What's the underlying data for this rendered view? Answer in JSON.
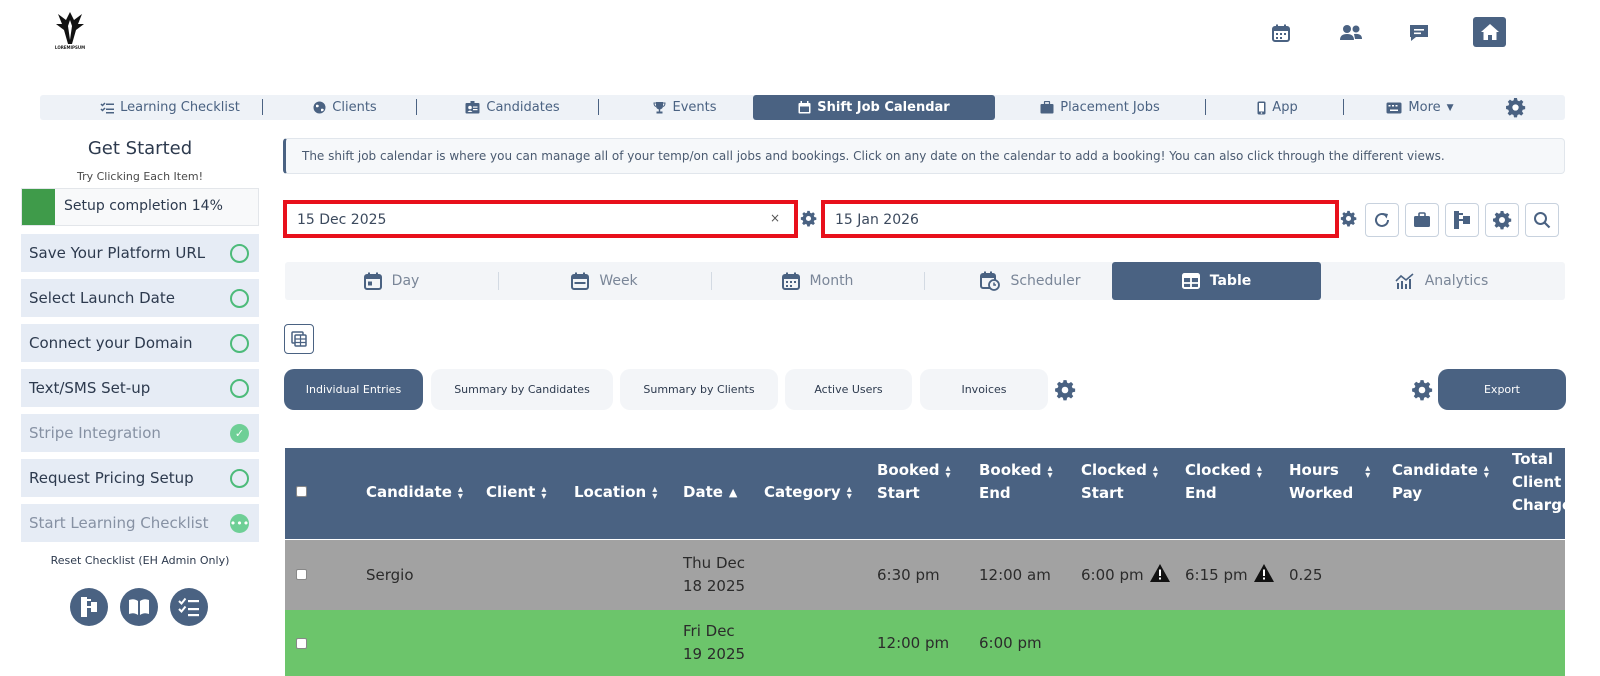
{
  "brand": {
    "logo_text": "LOREMIPSUM"
  },
  "header_icons": [
    "calendar-icon",
    "users-icon",
    "chat-icon",
    "home-icon"
  ],
  "nav": {
    "items": [
      {
        "label": "Learning Checklist",
        "icon": "checklist-icon"
      },
      {
        "label": "Clients",
        "icon": "globe-icon"
      },
      {
        "label": "Candidates",
        "icon": "id-badge-icon"
      },
      {
        "label": "Events",
        "icon": "trophy-icon"
      },
      {
        "label": "Shift Job Calendar",
        "icon": "calendar-icon",
        "active": true
      },
      {
        "label": "Placement Jobs",
        "icon": "briefcase-icon"
      },
      {
        "label": "App",
        "icon": "mobile-icon"
      },
      {
        "label": "More",
        "icon": "keyboard-icon"
      }
    ]
  },
  "sidebar": {
    "title": "Get Started",
    "subtitle": "Try Clicking Each Item!",
    "setup_label": "Setup completion 14%",
    "setup_progress": 0.14,
    "steps": [
      {
        "label": "Save Your Platform URL",
        "state": "open"
      },
      {
        "label": "Select Launch Date",
        "state": "open"
      },
      {
        "label": "Connect your Domain",
        "state": "open"
      },
      {
        "label": "Text/SMS Set-up",
        "state": "open"
      },
      {
        "label": "Stripe Integration",
        "state": "done"
      },
      {
        "label": "Request Pricing Setup",
        "state": "open"
      },
      {
        "label": "Start Learning Checklist",
        "state": "pending"
      }
    ],
    "reset_label": "Reset Checklist (EH Admin Only)"
  },
  "info_text": "The shift job calendar is where you can manage all of your temp/on call jobs and bookings. Click on any date on the calendar to add a booking! You can also click through the different views.",
  "date_range": {
    "start": "15 Dec 2025",
    "end": "15 Jan 2026",
    "clear": "×"
  },
  "views": [
    {
      "label": "Day"
    },
    {
      "label": "Week"
    },
    {
      "label": "Month"
    },
    {
      "label": "Scheduler"
    },
    {
      "label": "Table",
      "active": true
    },
    {
      "label": "Analytics"
    }
  ],
  "subtabs": [
    "Individual Entries",
    "Summary by Candidates",
    "Summary by Clients",
    "Active Users",
    "Invoices"
  ],
  "export_label": "Export",
  "table": {
    "columns": [
      {
        "line1": "Candidate",
        "line2": ""
      },
      {
        "line1": "Client",
        "line2": ""
      },
      {
        "line1": "Location",
        "line2": ""
      },
      {
        "line1": "Date",
        "line2": ""
      },
      {
        "line1": "Category",
        "line2": ""
      },
      {
        "line1": "Booked",
        "line2": "Start"
      },
      {
        "line1": "Booked",
        "line2": "End"
      },
      {
        "line1": "Clocked",
        "line2": "Start"
      },
      {
        "line1": "Clocked",
        "line2": "End"
      },
      {
        "line1": "Hours",
        "line2": "Worked"
      },
      {
        "line1": "Candidate",
        "line2": "Pay"
      },
      {
        "line1": "Total",
        "line2": "Client",
        "line3": "Charge"
      }
    ],
    "rows": [
      {
        "candidate": "Sergio",
        "client": "",
        "location": "",
        "date_line1": "Thu Dec",
        "date_line2": "18 2025",
        "category": "",
        "booked_start": "6:30 pm",
        "booked_end": "12:00 am",
        "clocked_start": "6:00 pm",
        "clocked_end": "6:15 pm",
        "hours": "0.25",
        "pay": "",
        "charge": "",
        "color": "#a2a2a2"
      },
      {
        "candidate": "",
        "client": "",
        "location": "",
        "date_line1": "Fri Dec",
        "date_line2": "19 2025",
        "category": "",
        "booked_start": "12:00 pm",
        "booked_end": "6:00 pm",
        "clocked_start": "",
        "clocked_end": "",
        "hours": "",
        "pay": "",
        "charge": "",
        "color": "#6cc56b"
      }
    ]
  }
}
